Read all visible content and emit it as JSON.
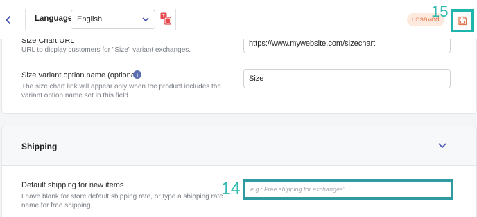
{
  "toolbar": {
    "language_label": "Language",
    "language_value": "English",
    "unsaved_badge": "unsaved",
    "save_callout": "15"
  },
  "size_chart": {
    "url_title": "Size Chart URL",
    "url_help": "URL to display customers for \"Size\" variant exchanges.",
    "url_value": "https://www.mywebsite.com/sizechart",
    "option_title": "Size variant option name (optional)",
    "option_help_line1": "The size chart link will appear only when the product includes the",
    "option_help_line2": "variant option name set in this field",
    "option_value": "Size"
  },
  "shipping": {
    "section_title": "Shipping",
    "field_title": "Default shipping for new items",
    "field_help_line1": "Leave blank for store default shipping rate, or type a shipping rate",
    "field_help_line2": "name for free shipping.",
    "input_placeholder": "e.g.: Free shipping for exchanges\"",
    "callout": "14"
  },
  "colors": {
    "callout_teal": "#2fb9b0",
    "unsaved_bg": "#fde9de",
    "unsaved_text": "#e0764d",
    "translate_red": "#e5484d",
    "info_blue": "#5b6eb0"
  },
  "icons": [
    "chevron-left-icon",
    "chevron-down-icon",
    "translate-icon",
    "save-icon",
    "info-icon"
  ]
}
